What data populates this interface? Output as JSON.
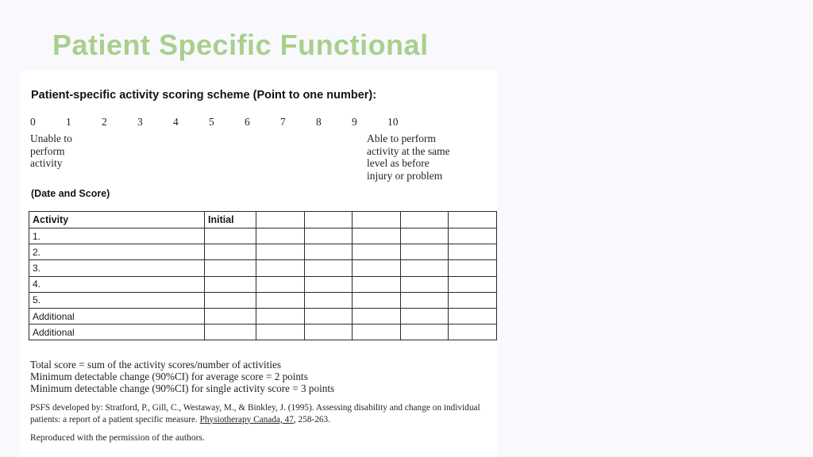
{
  "slide": {
    "title": "Patient Specific Functional",
    "title_color": "#a8d08d",
    "background_color": "#f9f9fd",
    "panel_color": "#ffffff"
  },
  "document": {
    "scheme_heading": "Patient-specific activity scoring scheme (Point to one number):",
    "scale": {
      "numbers": [
        "0",
        "1",
        "2",
        "3",
        "4",
        "5",
        "6",
        "7",
        "8",
        "9",
        "10"
      ],
      "anchor_low": "Unable to\nperform\nactivity",
      "anchor_high": "Able to perform\nactivity at the same\nlevel as before\ninjury or problem"
    },
    "date_score_label": "(Date and Score)",
    "table": {
      "headers": [
        "Activity",
        "Initial",
        "",
        "",
        "",
        "",
        ""
      ],
      "rows": [
        [
          "1.",
          "",
          "",
          "",
          "",
          "",
          ""
        ],
        [
          "2.",
          "",
          "",
          "",
          "",
          "",
          ""
        ],
        [
          "3.",
          "",
          "",
          "",
          "",
          "",
          ""
        ],
        [
          "4.",
          "",
          "",
          "",
          "",
          "",
          ""
        ],
        [
          "5.",
          "",
          "",
          "",
          "",
          "",
          ""
        ],
        [
          "Additional",
          "",
          "",
          "",
          "",
          "",
          ""
        ],
        [
          "Additional",
          "",
          "",
          "",
          "",
          "",
          ""
        ]
      ]
    },
    "scoring_notes": [
      "Total score = sum of the activity scores/number of activities",
      "Minimum detectable change (90%CI) for average score = 2 points",
      "Minimum detectable change (90%CI) for single activity score = 3 points"
    ],
    "citation": {
      "line_start": "PSFS developed by:  Stratford, P., Gill, C., Westaway, M., & Binkley, J. (1995). Assessing disability and change on individual patients: a report of a patient specific measure.  ",
      "journal": "Physiotherapy Canada,  47",
      "line_end": ", 258-263."
    },
    "permission_note": "Reproduced with the permission of the authors."
  }
}
